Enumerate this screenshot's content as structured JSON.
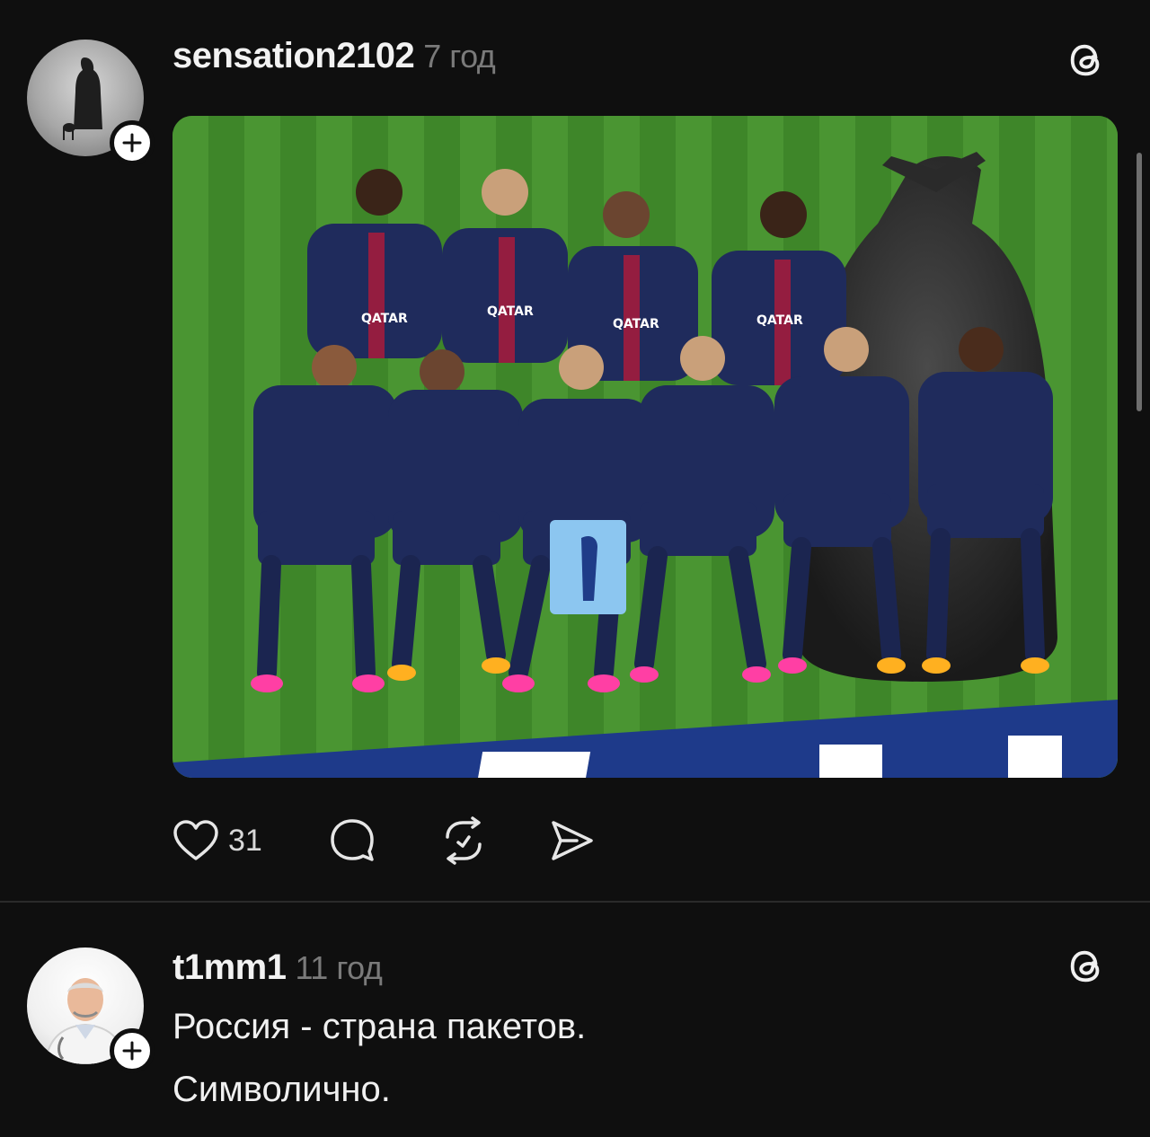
{
  "posts": [
    {
      "username": "sensation2102",
      "time": "7 год",
      "likes": "31",
      "media_description": "PSG team photo with a black garbage bag standing in the lineup",
      "icons": [
        "threads-logo-icon",
        "follow-plus-icon",
        "heart-icon",
        "comment-icon",
        "repost-icon",
        "share-icon"
      ]
    },
    {
      "username": "t1mm1",
      "time": "11 год",
      "lines": [
        "Россия - страна пакетов.",
        "Символично."
      ],
      "icons": [
        "threads-logo-icon",
        "follow-plus-icon"
      ]
    }
  ],
  "colors": {
    "background": "#0f0f0f",
    "pitch": "#3f8a2c",
    "jersey": "#1f2b5c",
    "boots": "#ff3fa4"
  }
}
